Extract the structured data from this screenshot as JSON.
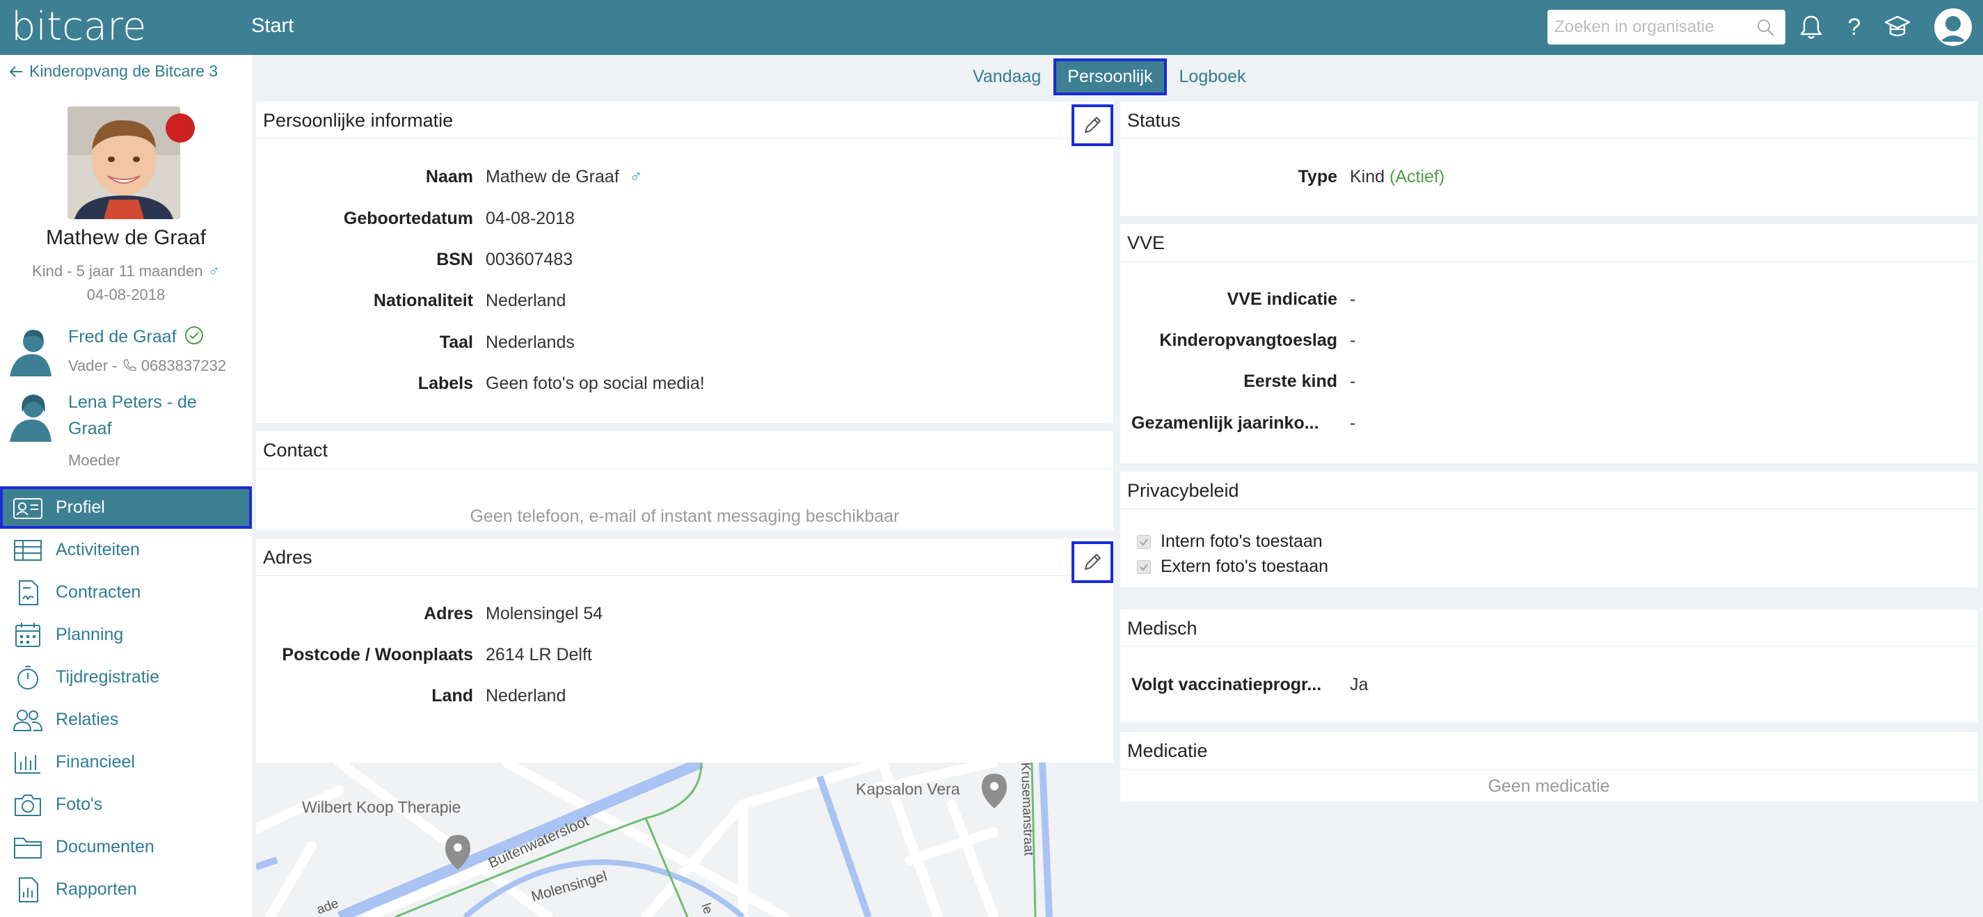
{
  "app": {
    "logo": "bitcare",
    "page_title": "Start"
  },
  "search": {
    "placeholder": "Zoeken in organisatie"
  },
  "sidebar": {
    "back_label": "Kinderopvang de Bitcare 3",
    "child": {
      "name": "Mathew de Graaf",
      "info": "Kind - 5 jaar 11 maanden",
      "gender_symbol": "♂",
      "birthdate": "04-08-2018"
    },
    "parents": [
      {
        "name": "Fred de Graaf",
        "role": "Vader - ",
        "phone": "0683837232"
      },
      {
        "name_line1": "Lena Peters - de",
        "name_line2": "Graaf",
        "role": "Moeder"
      }
    ],
    "nav": [
      {
        "label": "Profiel",
        "icon": "id-card-icon"
      },
      {
        "label": "Activiteiten",
        "icon": "table-icon"
      },
      {
        "label": "Contracten",
        "icon": "contract-icon"
      },
      {
        "label": "Planning",
        "icon": "calendar-icon"
      },
      {
        "label": "Tijdregistratie",
        "icon": "stopwatch-icon"
      },
      {
        "label": "Relaties",
        "icon": "people-icon"
      },
      {
        "label": "Financieel",
        "icon": "bar-chart-icon"
      },
      {
        "label": "Foto's",
        "icon": "camera-icon"
      },
      {
        "label": "Documenten",
        "icon": "folder-icon"
      },
      {
        "label": "Rapporten",
        "icon": "report-icon"
      }
    ]
  },
  "tabs": [
    {
      "label": "Vandaag"
    },
    {
      "label": "Persoonlijk"
    },
    {
      "label": "Logboek"
    }
  ],
  "personal": {
    "title": "Persoonlijke informatie",
    "fields": [
      {
        "label": "Naam",
        "value": "Mathew de Graaf",
        "gender_symbol": "♂"
      },
      {
        "label": "Geboortedatum",
        "value": "04-08-2018"
      },
      {
        "label": "BSN",
        "value": "003607483"
      },
      {
        "label": "Nationaliteit",
        "value": "Nederland"
      },
      {
        "label": "Taal",
        "value": "Nederlands"
      },
      {
        "label": "Labels",
        "value": "Geen foto's op social media!"
      }
    ]
  },
  "contact": {
    "title": "Contact",
    "empty": "Geen telefoon, e-mail of instant messaging beschikbaar"
  },
  "address": {
    "title": "Adres",
    "fields": [
      {
        "label": "Adres",
        "value": "Molensingel 54"
      },
      {
        "label": "Postcode / Woonplaats",
        "value": "2614 LR Delft"
      },
      {
        "label": "Land",
        "value": "Nederland"
      }
    ]
  },
  "map": {
    "labels": {
      "poi1": "Wilbert Koop Therapie",
      "poi2": "Kapsalon Vera",
      "street1": "Buitenwatersloot",
      "street2": "Molensingel",
      "street3": "Krusemanstraat",
      "street4": "ade",
      "street5": "le"
    }
  },
  "status": {
    "title": "Status",
    "label": "Type",
    "value": "Kind",
    "status": "(Actief)"
  },
  "vve": {
    "title": "VVE",
    "fields": [
      {
        "label": "VVE indicatie",
        "value": "-"
      },
      {
        "label": "Kinderopvangtoeslag",
        "value": "-"
      },
      {
        "label": "Eerste kind",
        "value": "-"
      },
      {
        "label": "Gezamenlijk jaarinko...",
        "value": "-"
      }
    ]
  },
  "privacy": {
    "title": "Privacybeleid",
    "items": [
      {
        "label": "Intern foto's toestaan",
        "checked": true
      },
      {
        "label": "Extern foto's toestaan",
        "checked": true
      }
    ]
  },
  "medical": {
    "title": "Medisch",
    "label": "Volgt vaccinatieprogr...",
    "value": "Ja"
  },
  "medication": {
    "title": "Medicatie",
    "empty": "Geen medicatie"
  },
  "colors": {
    "primary": "#3d7f93",
    "link": "#2f7c93",
    "highlight": "#1a2bd8",
    "status_red": "#cc2222",
    "active_green": "#4c9e45"
  }
}
